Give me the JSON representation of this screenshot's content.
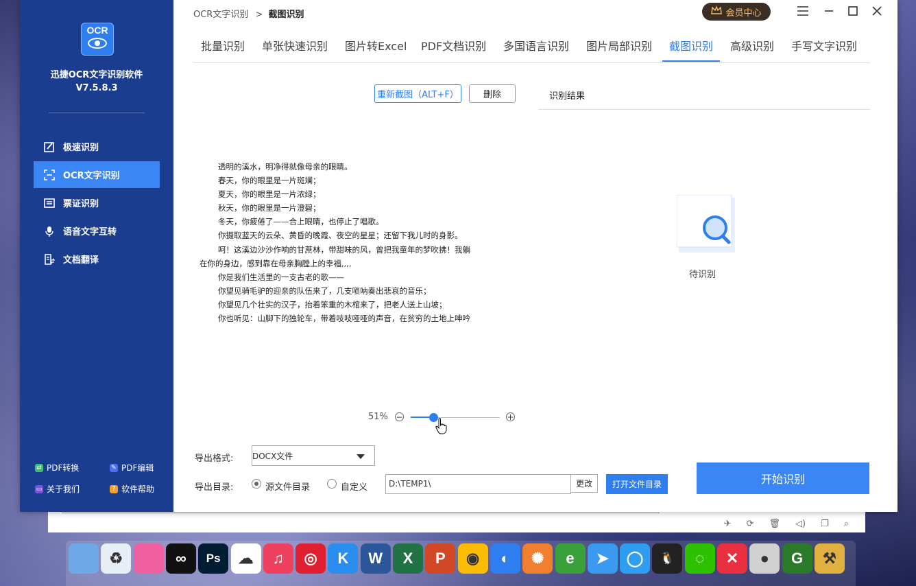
{
  "app": {
    "name": "迅捷OCR文字识别软件",
    "version": "V7.5.8.3",
    "logo_text": "OCR"
  },
  "sidebar": {
    "items": [
      {
        "label": "极速识别",
        "icon": "fast-recognize-icon"
      },
      {
        "label": "OCR文字识别",
        "icon": "scan-icon",
        "active": true
      },
      {
        "label": "票证识别",
        "icon": "ticket-icon"
      },
      {
        "label": "语音文字互转",
        "icon": "microphone-icon"
      },
      {
        "label": "文档翻译",
        "icon": "translate-icon"
      }
    ],
    "footer": [
      {
        "label": "PDF转换",
        "icon": "pdf-convert-icon",
        "color": "#3fbf73"
      },
      {
        "label": "PDF编辑",
        "icon": "pdf-edit-icon",
        "color": "#4c6ff2"
      },
      {
        "label": "关于我们",
        "icon": "about-icon",
        "color": "#7a53d9"
      },
      {
        "label": "软件帮助",
        "icon": "help-icon",
        "color": "#f0a030"
      }
    ]
  },
  "header": {
    "breadcrumb_root": "OCR文字识别",
    "breadcrumb_sep": ">",
    "breadcrumb_current": "截图识别",
    "vip_label": "会员中心"
  },
  "tabs": [
    {
      "label": "批量识别"
    },
    {
      "label": "单张快速识别"
    },
    {
      "label": "图片转Excel"
    },
    {
      "label": "PDF文档识别"
    },
    {
      "label": "多国语言识别"
    },
    {
      "label": "图片局部识别"
    },
    {
      "label": "截图识别",
      "active": true
    },
    {
      "label": "高级识别"
    },
    {
      "label": "手写文字识别"
    }
  ],
  "toolbar": {
    "recapture_label": "重新截图（ALT+F）",
    "delete_label": "删除"
  },
  "result": {
    "title": "识别结果",
    "status": "待识别"
  },
  "poem_lines": [
    "透明的溪水，明净得就像母亲的眼睛。",
    "春天，你的眼里是一片斑斓；",
    "夏天，你的眼里是一片浓绿；",
    "秋天，你的眼里是一片澄碧；",
    "冬天，你疲倦了——合上眼睛，也停止了唱歌。",
    "你摄取蓝天的云朵、黄昏的晚霞、夜空的星星；还留下我儿时的身影。",
    "呵！这溪边沙沙作响的甘蔗林，带甜味的风，曾把我童年的梦吹拂！我躺",
    "在你的身边，感到靠在母亲胸膛上的幸福,,,,",
    "你是我们生活里的一支古老的歌——",
    "你望见骑毛驴的迎亲的队伍来了，几支唢呐奏出悲哀的音乐；",
    "你望见几个壮实的汉子，抬着笨重的木棺来了，把老人送上山坡；",
    "你也听见：山脚下的独轮车，带着吱吱哑哑的声音，在贫穷的土地上呻吟"
  ],
  "zoom": {
    "label": "51%",
    "value": 0.26
  },
  "export": {
    "format_label": "导出格式:",
    "format_value": "DOCX文件",
    "dir_label": "导出目录:",
    "dir_option_source": "源文件目录",
    "dir_option_custom": "自定义",
    "path_value": "D:\\TEMP1\\",
    "change_label": "更改",
    "open_label": "打开文件目录"
  },
  "start_label": "开始识别",
  "taskbar": {
    "tools": [
      "pin-icon",
      "history-icon",
      "trash-icon",
      "volume-icon",
      "restore-icon",
      "search-icon"
    ]
  },
  "dock": {
    "apps": [
      {
        "icon": "computer-icon",
        "text": "",
        "color": "#6fa8e8"
      },
      {
        "icon": "recycle-bin-icon",
        "text": "♻",
        "color": "#e8eef5"
      },
      {
        "icon": "petal-icon",
        "text": "",
        "color": "#f060a0"
      },
      {
        "icon": "beeline-icon",
        "text": "∞",
        "color": "#111111"
      },
      {
        "icon": "photoshop-icon",
        "text": "Ps",
        "color": "#001d34"
      },
      {
        "icon": "baidu-cloud-icon",
        "text": "☁",
        "color": "#ffffff"
      },
      {
        "icon": "music-icon",
        "text": "♫",
        "color": "#f04060"
      },
      {
        "icon": "netease-music-icon",
        "text": "◎",
        "color": "#e02030"
      },
      {
        "icon": "kugou-icon",
        "text": "K",
        "color": "#2a8ef0"
      },
      {
        "icon": "word-icon",
        "text": "W",
        "color": "#2b579a"
      },
      {
        "icon": "excel-icon",
        "text": "X",
        "color": "#217346"
      },
      {
        "icon": "powerpoint-icon",
        "text": "P",
        "color": "#d24726"
      },
      {
        "icon": "chrome-icon",
        "text": "◉",
        "color": "#fbbc05"
      },
      {
        "icon": "browser-icon",
        "text": "◐",
        "color": "#2f7ef0"
      },
      {
        "icon": "pinwheel-icon",
        "text": "✺",
        "color": "#f08030"
      },
      {
        "icon": "ie-icon",
        "text": "e",
        "color": "#3aa03a"
      },
      {
        "icon": "feishu-icon",
        "text": "➤",
        "color": "#3a9af0"
      },
      {
        "icon": "chat-icon",
        "text": "◯",
        "color": "#2f9ef0"
      },
      {
        "icon": "qq-icon",
        "text": "🐧",
        "color": "#222222"
      },
      {
        "icon": "wechat-icon",
        "text": "◌",
        "color": "#2dc100"
      },
      {
        "icon": "xmind-icon",
        "text": "✕",
        "color": "#e83040"
      },
      {
        "icon": "screen-record-icon",
        "text": "●",
        "color": "#d0d0d0"
      },
      {
        "icon": "g-app-icon",
        "text": "G",
        "color": "#2a7a2a"
      },
      {
        "icon": "tools-icon",
        "text": "⚒",
        "color": "#e0b040"
      }
    ]
  }
}
